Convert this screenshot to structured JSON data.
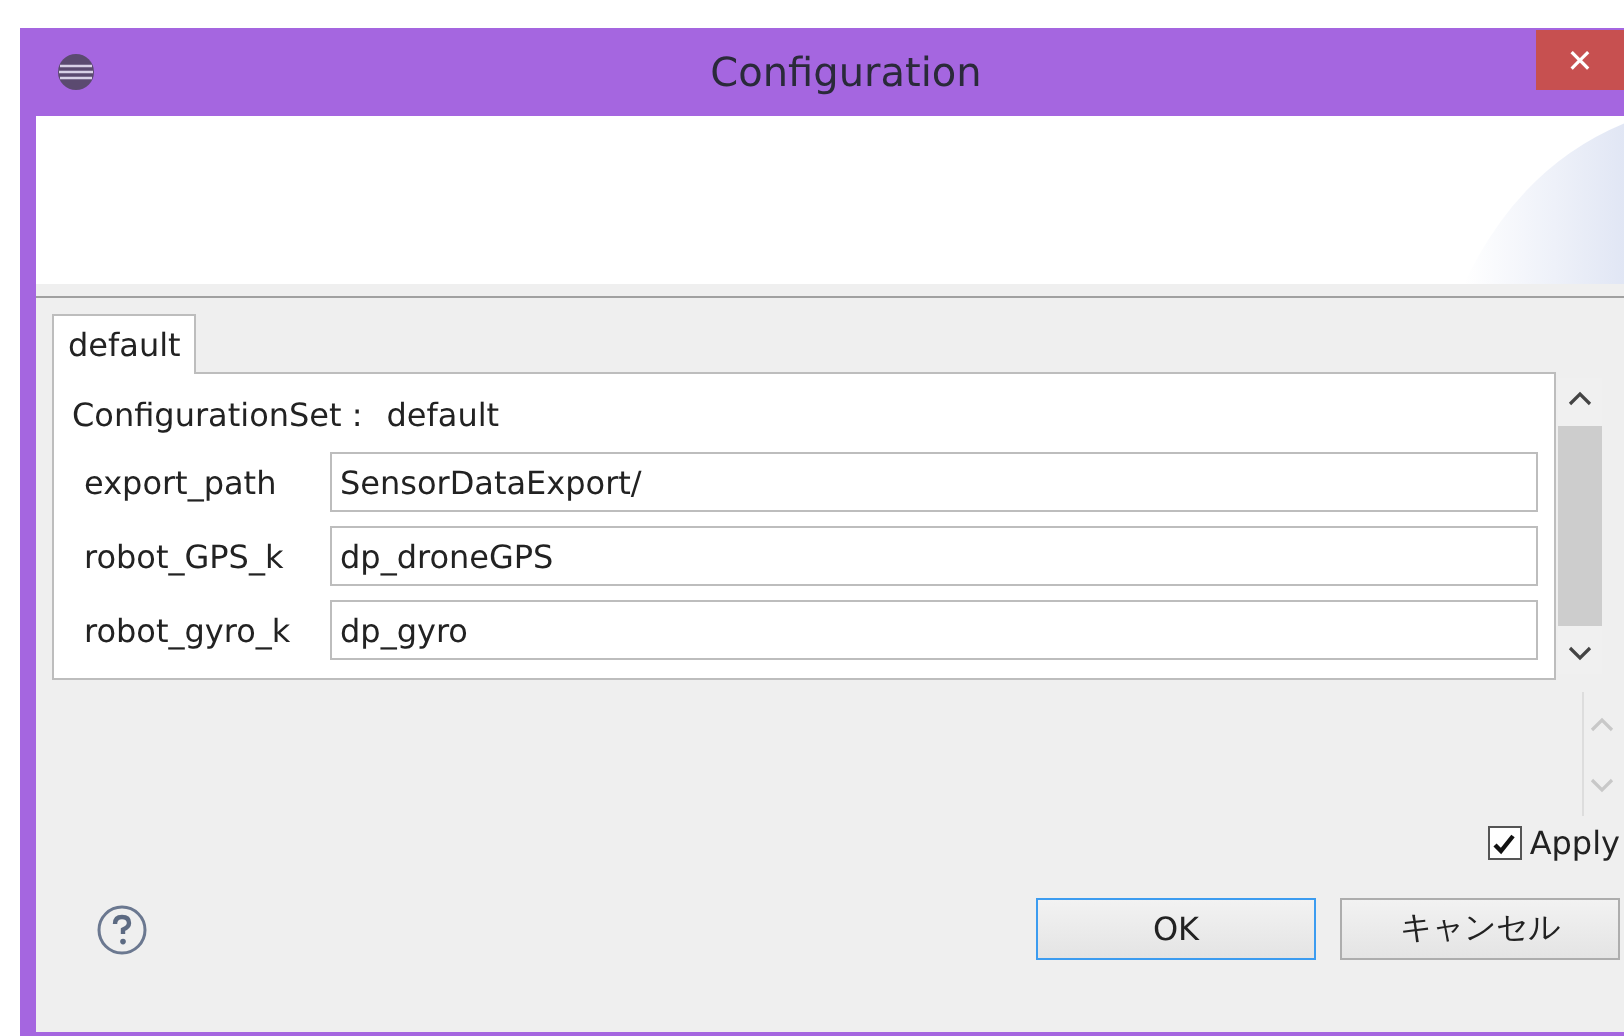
{
  "window": {
    "title": "Configuration",
    "close": "✕"
  },
  "tabs": [
    {
      "label": "default",
      "selected": true
    }
  ],
  "configuration_set": {
    "label": "ConfigurationSet :",
    "value": "default"
  },
  "fields": [
    {
      "label": "export_path",
      "value": "SensorDataExport/"
    },
    {
      "label": "robot_GPS_k",
      "value": "dp_droneGPS"
    },
    {
      "label": "robot_gyro_k",
      "value": "dp_gyro"
    }
  ],
  "apply": {
    "label": "Apply",
    "checked": true
  },
  "buttons": [
    {
      "label": "OK",
      "kind": "default"
    },
    {
      "label": "キャンセル",
      "kind": "normal"
    }
  ]
}
